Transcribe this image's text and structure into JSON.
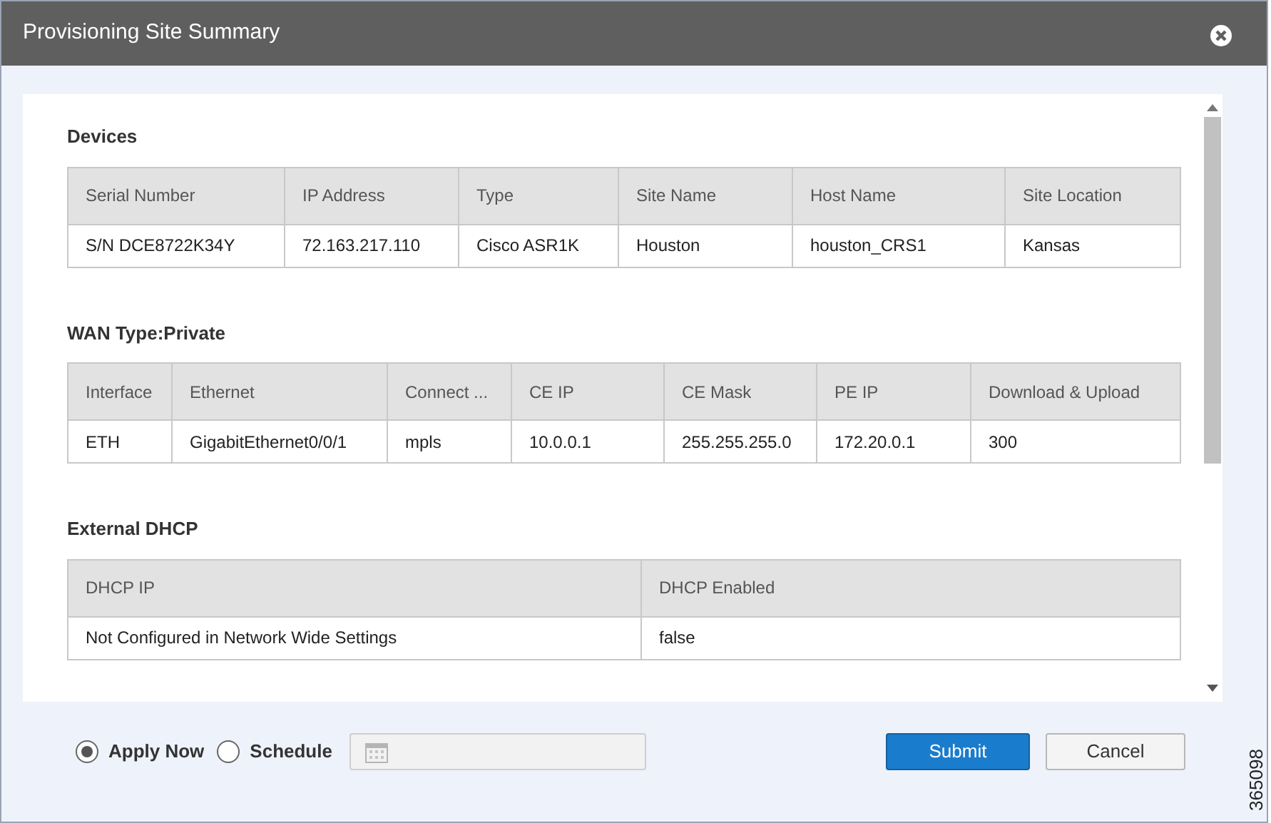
{
  "window": {
    "title": "Provisioning Site Summary"
  },
  "sections": [
    {
      "title": "Devices",
      "columns": [
        "Serial Number",
        "IP Address",
        "Type",
        "Site Name",
        "Host Name",
        "Site Location"
      ],
      "rows": [
        [
          "S/N DCE8722K34Y",
          "72.163.217.110",
          "Cisco ASR1K",
          "Houston",
          "houston_CRS1",
          "Kansas"
        ]
      ]
    },
    {
      "title": "WAN Type:Private",
      "columns": [
        "Interface",
        "Ethernet",
        "Connect ...",
        "CE IP",
        "CE Mask",
        "PE IP",
        "Download & Upload"
      ],
      "rows": [
        [
          "ETH",
          "GigabitEthernet0/0/1",
          "mpls",
          "10.0.0.1",
          "255.255.255.0",
          "172.20.0.1",
          "300"
        ]
      ]
    },
    {
      "title": "External DHCP",
      "columns": [
        "DHCP IP",
        "DHCP Enabled"
      ],
      "rows": [
        [
          "Not Configured in Network Wide Settings",
          "false"
        ]
      ]
    }
  ],
  "schedule_options": [
    {
      "label": "Apply Now",
      "selected": true
    },
    {
      "label": "Schedule",
      "selected": false
    }
  ],
  "buttons": [
    {
      "label": "Submit",
      "kind": "primary"
    },
    {
      "label": "Cancel",
      "kind": "secondary"
    }
  ],
  "figure_id": "365098"
}
